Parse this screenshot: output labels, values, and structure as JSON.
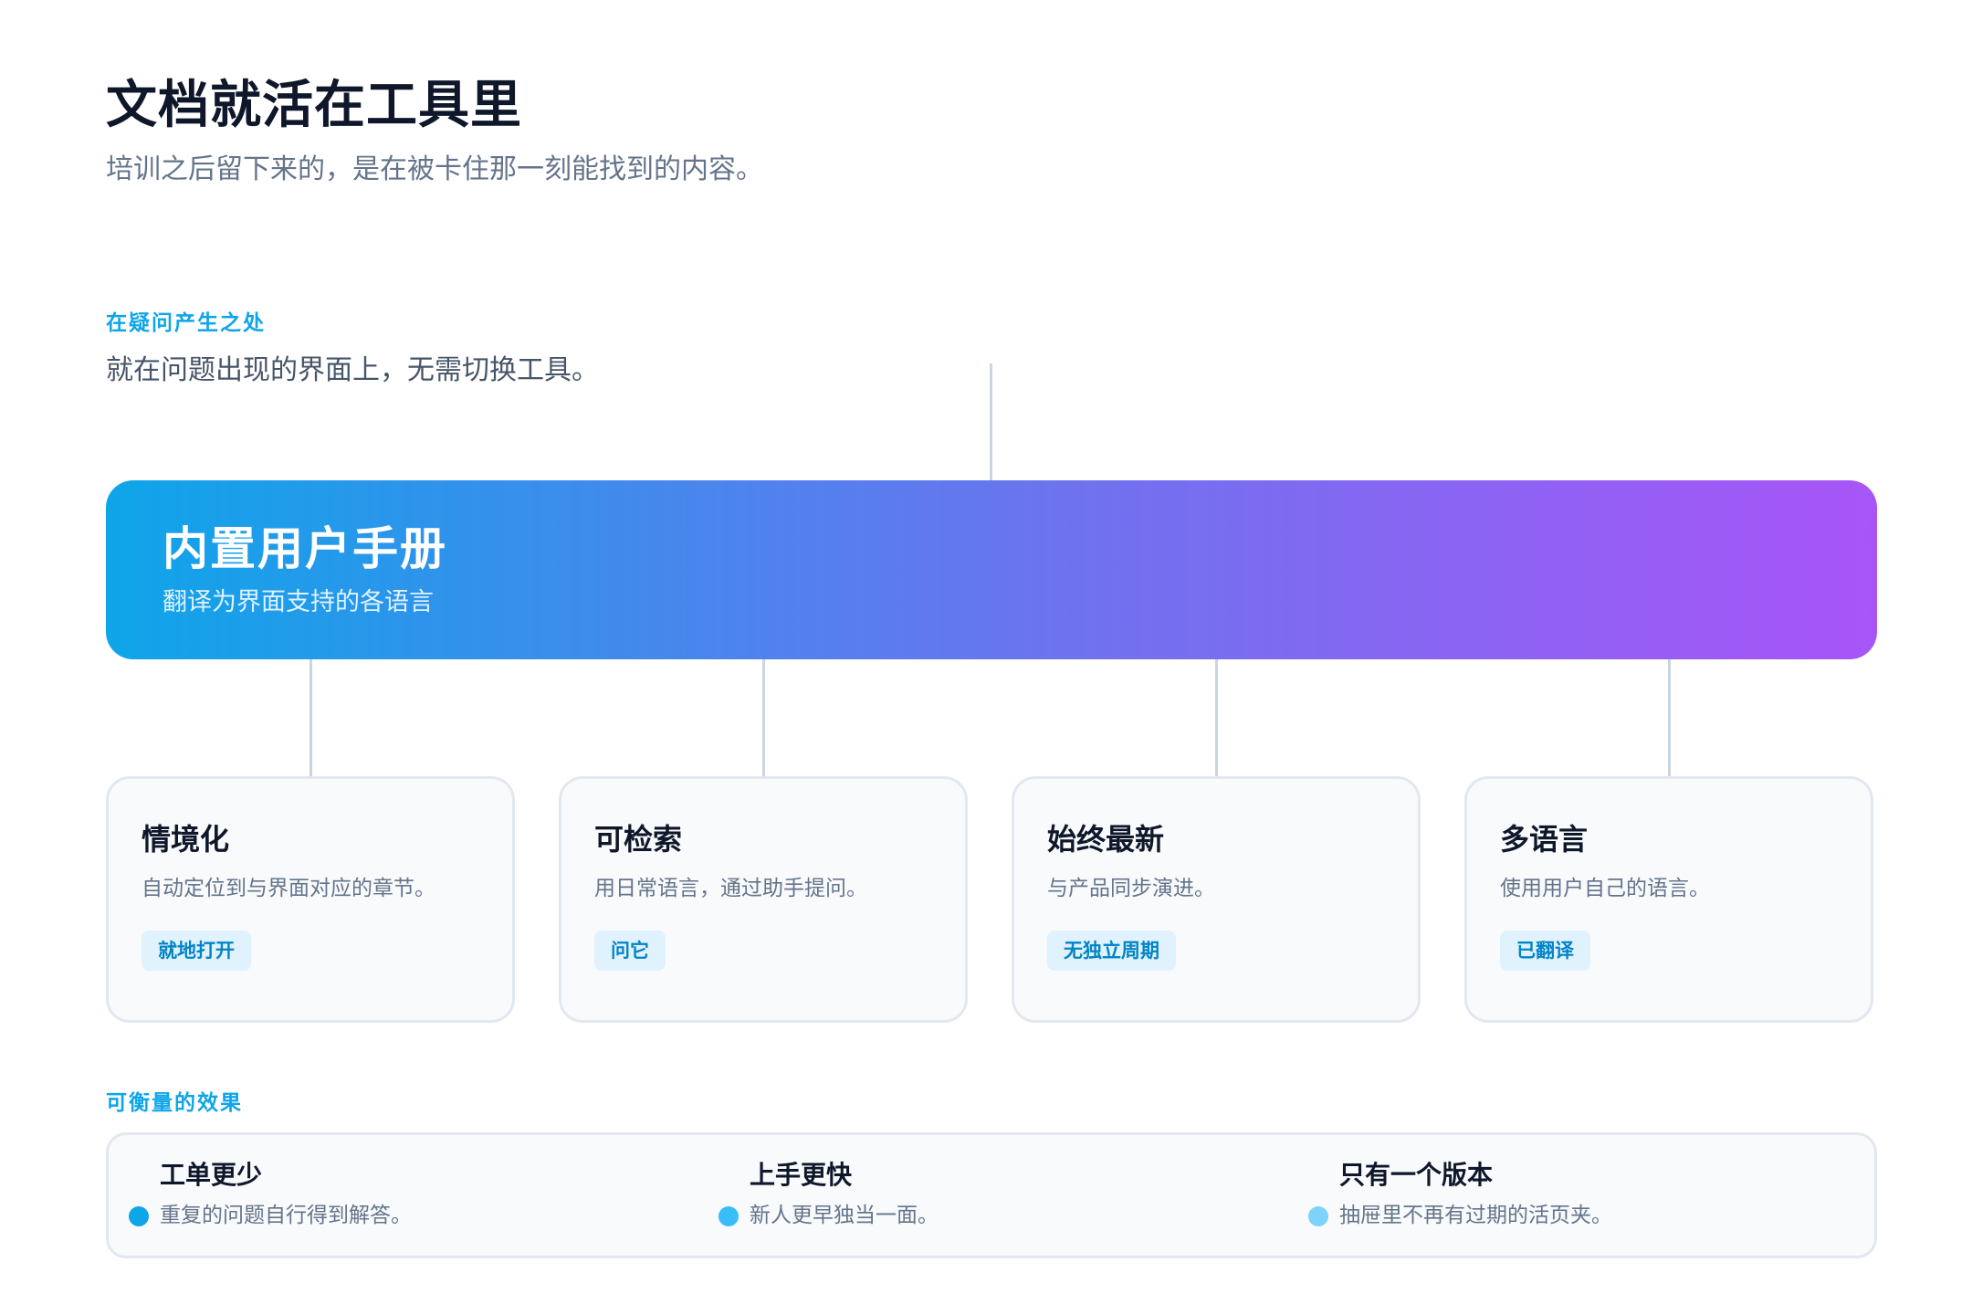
{
  "header": {
    "title": "文档就活在工具里",
    "subtitle": "培训之后留下来的，是在被卡住那一刻能找到的内容。"
  },
  "section_context": {
    "label": "在疑问产生之处",
    "description": "就在问题出现的界面上，无需切换工具。"
  },
  "hero": {
    "title": "内置用户手册",
    "subtitle": "翻译为界面支持的各语言"
  },
  "cards": [
    {
      "title": "情境化",
      "description": "自动定位到与界面对应的章节。",
      "tag": "就地打开"
    },
    {
      "title": "可检索",
      "description": "用日常语言，通过助手提问。",
      "tag": "问它"
    },
    {
      "title": "始终最新",
      "description": "与产品同步演进。",
      "tag": "无独立周期"
    },
    {
      "title": "多语言",
      "description": "使用用户自己的语言。",
      "tag": "已翻译"
    }
  ],
  "section_outcomes": {
    "label": "可衡量的效果"
  },
  "metrics": [
    {
      "title": "工单更少",
      "description": "重复的问题自行得到解答。",
      "dot_color": "#0ea5e9"
    },
    {
      "title": "上手更快",
      "description": "新人更早独当一面。",
      "dot_color": "#38bdf8"
    },
    {
      "title": "只有一个版本",
      "description": "抽屉里不再有过期的活页夹。",
      "dot_color": "#7dd3fc"
    }
  ],
  "colors": {
    "accent": "#0ea5e9",
    "gradient_start": "#0ea5e9",
    "gradient_end": "#a855f7",
    "connector": "#cbd5e1"
  }
}
